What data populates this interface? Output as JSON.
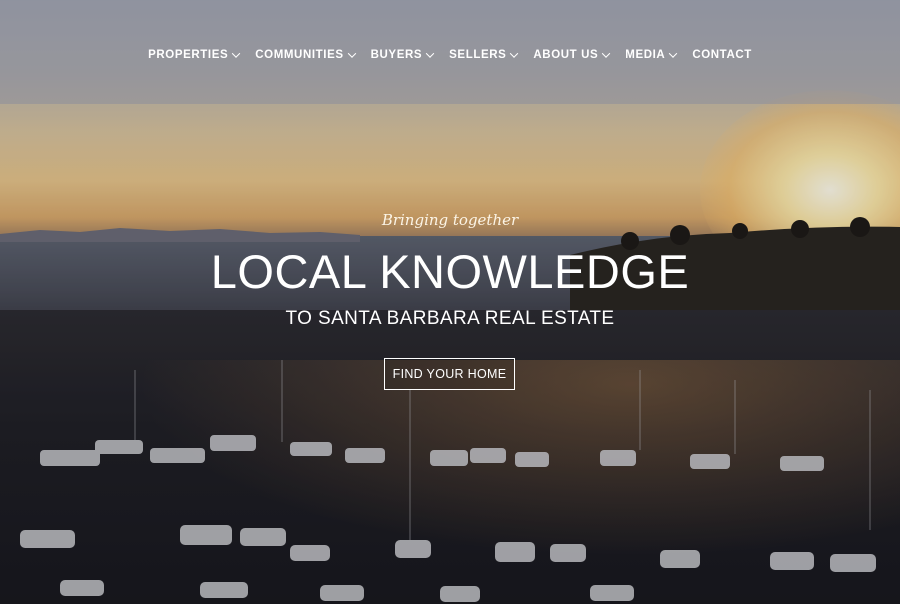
{
  "nav": {
    "items": [
      {
        "label": "PROPERTIES",
        "has_dropdown": true
      },
      {
        "label": "COMMUNITIES",
        "has_dropdown": true
      },
      {
        "label": "BUYERS",
        "has_dropdown": true
      },
      {
        "label": "SELLERS",
        "has_dropdown": true
      },
      {
        "label": "ABOUT US",
        "has_dropdown": true
      },
      {
        "label": "MEDIA",
        "has_dropdown": true
      },
      {
        "label": "CONTACT",
        "has_dropdown": false
      }
    ]
  },
  "hero": {
    "tagline": "Bringing together",
    "headline": "LOCAL KNOWLEDGE",
    "subhead": "TO SANTA BARBARA REAL ESTATE",
    "cta_label": "FIND YOUR HOME"
  }
}
